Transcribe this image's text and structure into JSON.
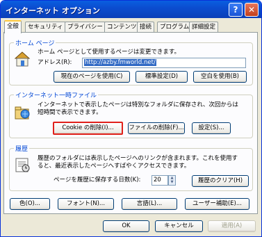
{
  "window": {
    "title": "インターネット オプション",
    "help_glyph": "?",
    "close_glyph": "✕"
  },
  "tabs": [
    "全般",
    "セキュリティ",
    "プライバシー",
    "コンテンツ",
    "接続",
    "プログラム",
    "詳細設定"
  ],
  "home": {
    "label": "ホーム ページ",
    "description": "ホーム ページとして使用するページは変更できます。",
    "address_label": "アドレス(R):",
    "address_value": "http://azby.fmworld.net/",
    "buttons": {
      "current": "現在のページを使用(C)",
      "default": "標準設定(D)",
      "blank": "空白を使用(B)"
    }
  },
  "temp": {
    "label": "インターネット一時ファイル",
    "description_line1": "インターネットで表示したページは特別なフォルダに保存され、次回からは",
    "description_line2": "短時間で表示できます。",
    "buttons": {
      "delete_cookies": "Cookie の削除(I)...",
      "delete_files": "ファイルの削除(F)...",
      "settings": "設定(S)..."
    }
  },
  "history": {
    "label": "履歴",
    "description_line1": "履歴のフォルダには表示したページへのリンクが含まれます。これを使用す",
    "description_line2": "ると、最近表示したページへすばやくアクセスできます。",
    "days_label": "ページを履歴に保存する日数(K):",
    "days_value": "20",
    "clear_button": "履歴のクリア(H)"
  },
  "bottom_buttons": {
    "colors": "色(O)...",
    "fonts": "フォント(N)...",
    "languages": "言語(L)...",
    "accessibility": "ユーザー補助(E)..."
  },
  "dialog_buttons": {
    "ok": "OK",
    "cancel": "キャンセル",
    "apply": "適用(A)"
  },
  "colors": {
    "titlebar": "#0b4dd0",
    "group_label": "#0046d5",
    "highlight_border": "#e0201a"
  }
}
